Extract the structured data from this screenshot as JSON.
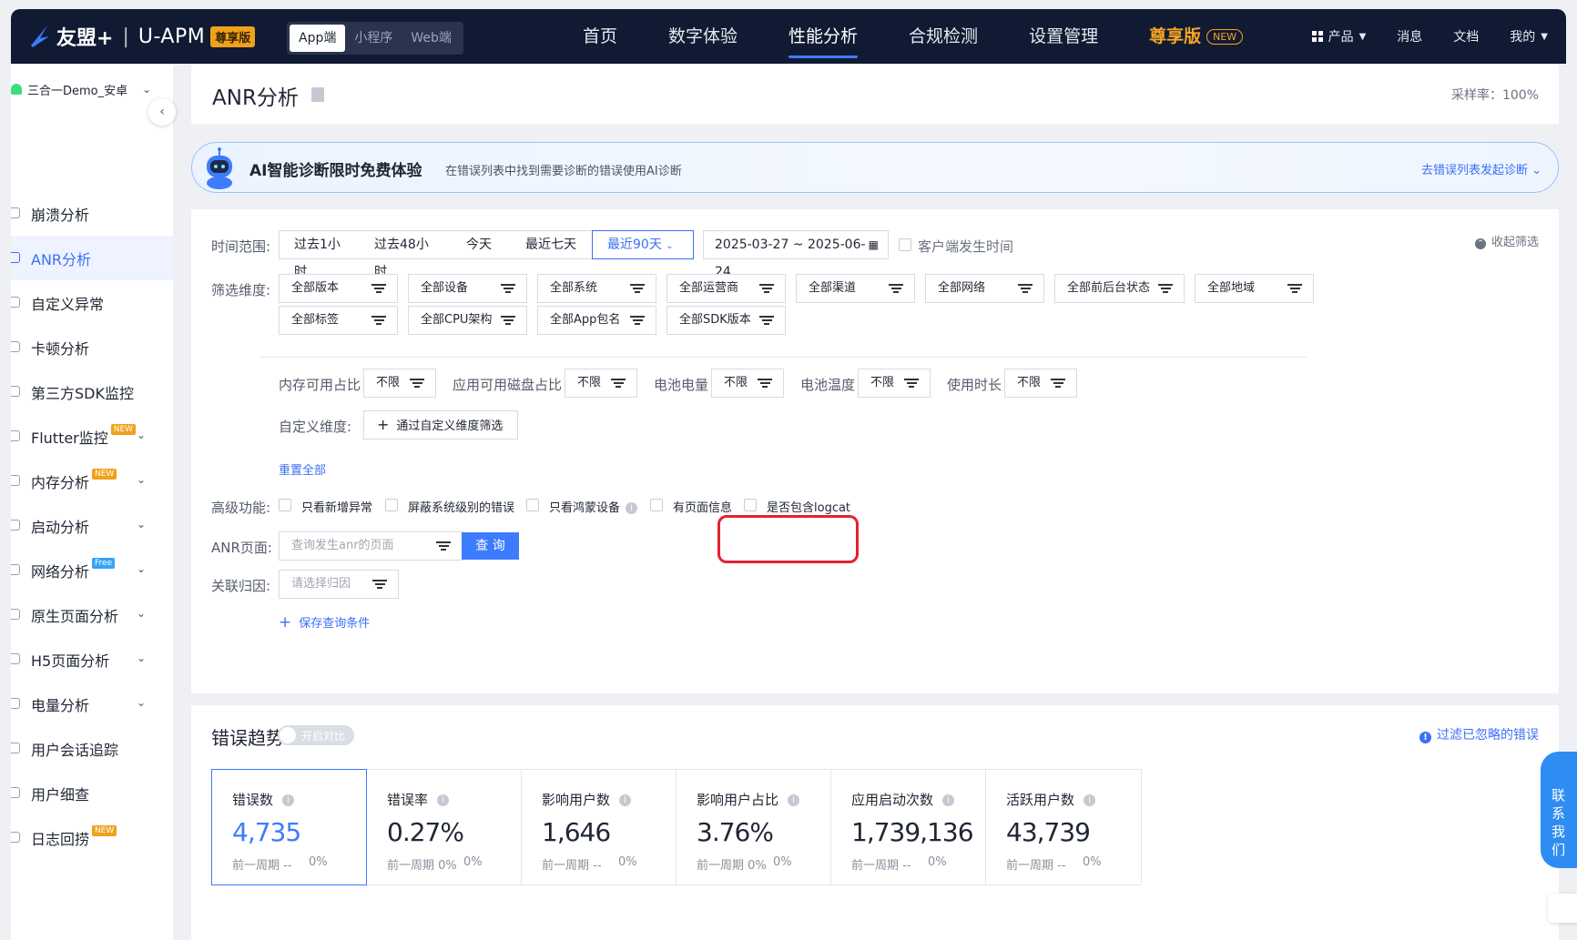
{
  "nav": {
    "brand": "友盟+",
    "product": "U-APM",
    "edition_badge": "尊享版",
    "platforms": [
      "App端",
      "小程序",
      "Web端"
    ],
    "active_platform": "App端",
    "items": [
      "首页",
      "数字体验",
      "性能分析",
      "合规检测",
      "设置管理"
    ],
    "vip_item": "尊享版",
    "vip_new": "NEW",
    "products": "产品",
    "messages": "消息",
    "docs": "文档",
    "mine": "我的"
  },
  "sidebar": {
    "app_name": "三合一Demo_安卓",
    "items": [
      {
        "label": "崩溃分析",
        "tag": "",
        "chev": false
      },
      {
        "label": "ANR分析",
        "tag": "",
        "chev": false,
        "active": true
      },
      {
        "label": "自定义异常",
        "tag": "",
        "chev": false
      },
      {
        "label": "卡顿分析",
        "tag": "",
        "chev": false
      },
      {
        "label": "第三方SDK监控",
        "tag": "",
        "chev": false
      },
      {
        "label": "Flutter监控",
        "tag": "NEW",
        "chev": true
      },
      {
        "label": "内存分析",
        "tag": "NEW",
        "chev": true
      },
      {
        "label": "启动分析",
        "tag": "",
        "chev": true
      },
      {
        "label": "网络分析",
        "tag": "Free",
        "chev": true
      },
      {
        "label": "原生页面分析",
        "tag": "",
        "chev": true
      },
      {
        "label": "H5页面分析",
        "tag": "",
        "chev": true
      },
      {
        "label": "电量分析",
        "tag": "",
        "chev": true
      },
      {
        "label": "用户会话追踪",
        "tag": "",
        "chev": false
      },
      {
        "label": "用户细查",
        "tag": "",
        "chev": false
      },
      {
        "label": "日志回捞",
        "tag": "NEW",
        "chev": false
      }
    ]
  },
  "page": {
    "title": "ANR分析",
    "sample_rate": "采样率：100%"
  },
  "ai_banner": {
    "headline": "AI智能诊断限时免费体验",
    "desc": "在错误列表中找到需要诊断的错误使用AI诊断",
    "link": "去错误列表发起诊断"
  },
  "filters": {
    "time_label": "时间范围:",
    "time_options": [
      "过去1小时",
      "过去48小时",
      "今天",
      "最近七天",
      "最近90天"
    ],
    "date_range": "2025-03-27 ~ 2025-06-24",
    "client_time": "客户端发生时间",
    "collapse": "收起筛选",
    "dim_label": "筛选维度:",
    "dims_row1": [
      "全部版本",
      "全部设备",
      "全部系统",
      "全部运营商",
      "全部渠道",
      "全部网络",
      "全部前后台状态",
      "全部地域"
    ],
    "dims_row2": [
      "全部标签",
      "全部CPU架构",
      "全部App包名",
      "全部SDK版本"
    ],
    "limit_filters": [
      {
        "label": "内存可用占比",
        "value": "不限"
      },
      {
        "label": "应用可用磁盘占比",
        "value": "不限"
      },
      {
        "label": "电池电量",
        "value": "不限"
      },
      {
        "label": "电池温度",
        "value": "不限"
      },
      {
        "label": "使用时长",
        "value": "不限"
      }
    ],
    "custom_label": "自定义维度:",
    "custom_btn": "通过自定义维度筛选",
    "reset": "重置全部",
    "adv_label": "高级功能:",
    "adv_opts": [
      "只看新增异常",
      "屏蔽系统级别的错误",
      "只看鸿蒙设备",
      "有页面信息",
      "是否包含logcat"
    ],
    "anr_page_label": "ANR页面:",
    "anr_page_placeholder": "查询发生anr的页面",
    "search_btn": "查 询",
    "cause_label": "关联归因:",
    "cause_placeholder": "请选择归因",
    "save": "保存查询条件"
  },
  "trend": {
    "title": "错误趋势",
    "compare": "开启对比",
    "ignore_link": "过滤已忽略的错误",
    "stats": [
      {
        "label": "错误数",
        "value": "4,735",
        "prev": "前一周期 --",
        "pct": "0%"
      },
      {
        "label": "错误率",
        "value": "0.27%",
        "prev": "前一周期 0%",
        "pct": "0%"
      },
      {
        "label": "影响用户数",
        "value": "1,646",
        "prev": "前一周期 --",
        "pct": "0%"
      },
      {
        "label": "影响用户占比",
        "value": "3.76%",
        "prev": "前一周期 0%",
        "pct": "0%"
      },
      {
        "label": "应用启动次数",
        "value": "1,739,136",
        "prev": "前一周期 --",
        "pct": "0%"
      },
      {
        "label": "活跃用户数",
        "value": "43,739",
        "prev": "前一周期 --",
        "pct": "0%"
      }
    ]
  },
  "contact": "联系我们"
}
